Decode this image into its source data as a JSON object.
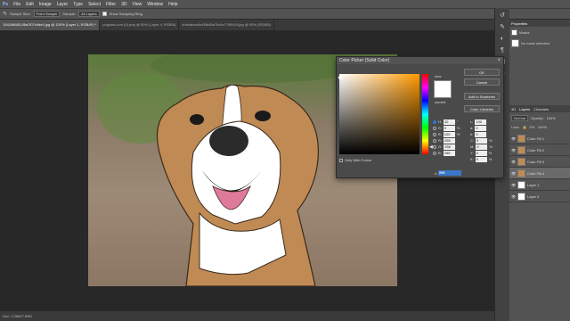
{
  "menu": [
    "File",
    "Edit",
    "Image",
    "Layer",
    "Type",
    "Select",
    "Filter",
    "3D",
    "View",
    "Window",
    "Help"
  ],
  "options": {
    "sample_size_label": "Sample Size:",
    "sample_size_value": "Point Sample",
    "sample_label": "Sample:",
    "sample_value": "All Layers",
    "show_ring_label": "Show Sampling Ring"
  },
  "tabs": [
    {
      "label": "154246683-98a7f07c9de4.jpg @ 100% (Layer 1, RGB/8*) *",
      "active": true
    },
    {
      "label": "puppies.com (5).png @ 50% (Layer 4, RGB/8)",
      "active": false
    },
    {
      "label": "chrt/labeo9e4f0b46e70c4e7798419.jpg @ 50% (RGB/8)",
      "active": false
    }
  ],
  "status": {
    "text": "Doc: 2.28M/7.89M"
  },
  "dialog": {
    "title": "Color Picker (Solid Color)",
    "ok": "OK",
    "cancel": "Cancel",
    "add_swatches": "Add to Swatches",
    "color_libraries": "Color Libraries",
    "new_label": "new",
    "current_label": "current",
    "only_web": "Only Web Colors",
    "fields_left": [
      {
        "label": "H:",
        "value": "32",
        "unit": "°",
        "selected": true
      },
      {
        "label": "S:",
        "value": "0",
        "unit": "%",
        "selected": false
      },
      {
        "label": "B:",
        "value": "100",
        "unit": "%",
        "selected": false
      },
      {
        "label": "R:",
        "value": "255",
        "unit": "",
        "selected": false
      },
      {
        "label": "G:",
        "value": "255",
        "unit": "",
        "selected": false
      },
      {
        "label": "B:",
        "value": "255",
        "unit": "",
        "selected": false
      }
    ],
    "fields_right": [
      {
        "label": "L:",
        "value": "100",
        "unit": ""
      },
      {
        "label": "a:",
        "value": "0",
        "unit": ""
      },
      {
        "label": "b:",
        "value": "0",
        "unit": ""
      },
      {
        "label": "C:",
        "value": "0",
        "unit": "%"
      },
      {
        "label": "M:",
        "value": "0",
        "unit": "%"
      },
      {
        "label": "Y:",
        "value": "0",
        "unit": "%"
      },
      {
        "label": "K:",
        "value": "0",
        "unit": "%"
      }
    ],
    "hex_label": "#",
    "hex_value": "ffffff",
    "hue_color": "#ff9900"
  },
  "properties": {
    "tab": "Properties",
    "masks_label": "Masks",
    "no_mask": "No mask selected"
  },
  "layers_panel": {
    "tabs": [
      "3D",
      "Layers",
      "Channels"
    ],
    "blend": "Normal",
    "opacity_label": "Opacity:",
    "opacity": "100%",
    "fill_label": "Fill:",
    "fill": "100%",
    "lock_label": "Lock:",
    "layers": [
      {
        "name": "Color Fill 1",
        "selected": false
      },
      {
        "name": "Color Fill 2",
        "selected": false
      },
      {
        "name": "Color Fill 3",
        "selected": false
      },
      {
        "name": "Color Fill 4",
        "selected": true
      },
      {
        "name": "Layer 1",
        "selected": false
      },
      {
        "name": "Layer 0",
        "selected": false
      }
    ]
  },
  "colors": {
    "dog_brown": "#c08a55",
    "dog_white": "#ffffff",
    "tongue": "#e07a9a",
    "nose": "#2b2b2b"
  }
}
